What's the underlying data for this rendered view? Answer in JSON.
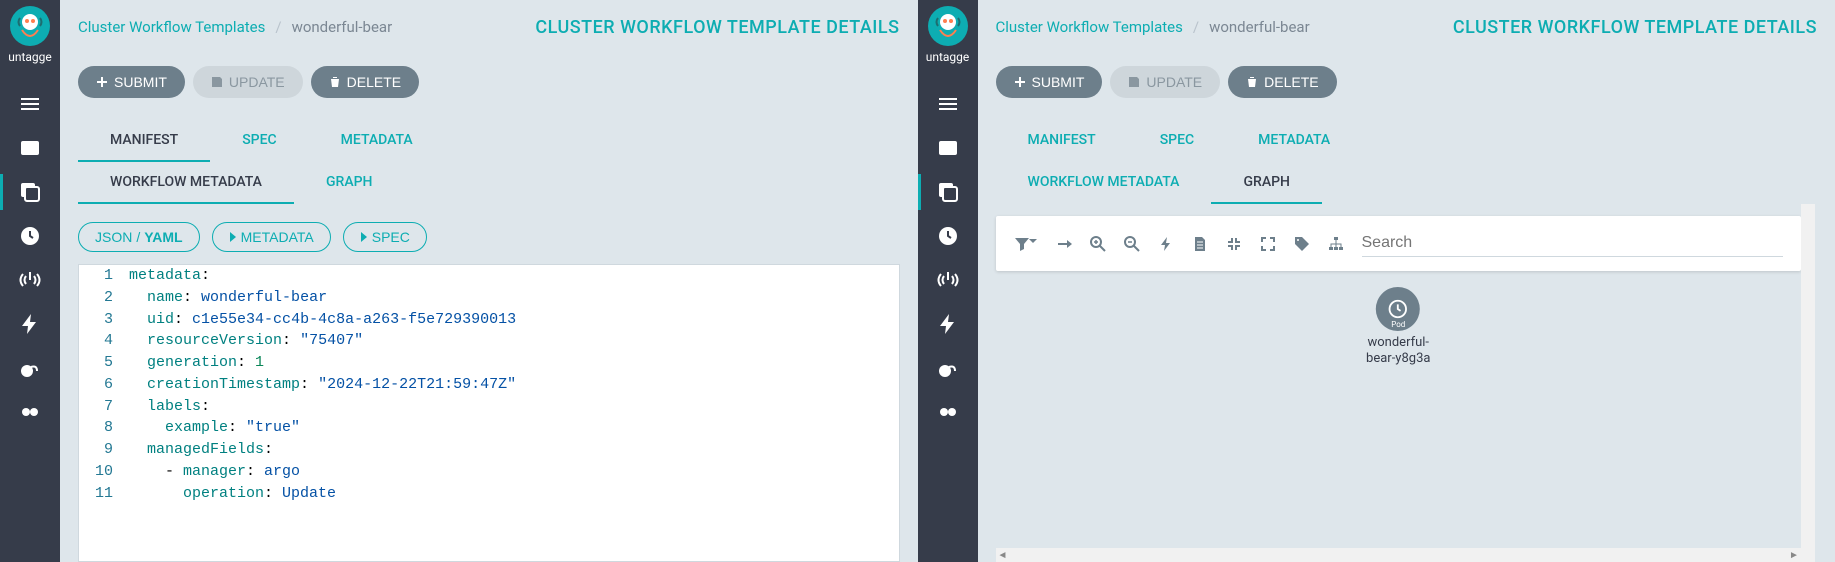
{
  "sidebar": {
    "tag": "untagge",
    "items": [
      {
        "name": "timeline-icon"
      },
      {
        "name": "workflows-icon"
      },
      {
        "name": "templates-icon",
        "active": true
      },
      {
        "name": "cron-icon"
      },
      {
        "name": "sensors-icon"
      },
      {
        "name": "events-icon"
      },
      {
        "name": "reports-icon"
      },
      {
        "name": "plugins-icon"
      }
    ]
  },
  "breadcrumb": {
    "parent": "Cluster Workflow Templates",
    "current": "wonderful-bear"
  },
  "page_title": "CLUSTER WORKFLOW TEMPLATE DETAILS",
  "toolbar": {
    "submit": "SUBMIT",
    "update": "UPDATE",
    "delete": "DELETE"
  },
  "tabs_primary": [
    "MANIFEST",
    "SPEC",
    "METADATA"
  ],
  "tabs_secondary": [
    "WORKFLOW METADATA",
    "GRAPH"
  ],
  "left": {
    "active_primary": 0,
    "active_secondary": 0,
    "pills": {
      "json": "JSON",
      "yaml": "YAML",
      "metadata": "METADATA",
      "spec": "SPEC"
    },
    "code_lines": [
      [
        {
          "t": "k",
          "v": "metadata"
        },
        {
          "t": "p",
          "v": ":"
        }
      ],
      [
        {
          "t": "p",
          "v": "  "
        },
        {
          "t": "k",
          "v": "name"
        },
        {
          "t": "p",
          "v": ": "
        },
        {
          "t": "s",
          "v": "wonderful-bear"
        }
      ],
      [
        {
          "t": "p",
          "v": "  "
        },
        {
          "t": "k",
          "v": "uid"
        },
        {
          "t": "p",
          "v": ": "
        },
        {
          "t": "s",
          "v": "c1e55e34-cc4b-4c8a-a263-f5e729390013"
        }
      ],
      [
        {
          "t": "p",
          "v": "  "
        },
        {
          "t": "k",
          "v": "resourceVersion"
        },
        {
          "t": "p",
          "v": ": "
        },
        {
          "t": "s",
          "v": "\"75407\""
        }
      ],
      [
        {
          "t": "p",
          "v": "  "
        },
        {
          "t": "k",
          "v": "generation"
        },
        {
          "t": "p",
          "v": ": "
        },
        {
          "t": "n",
          "v": "1"
        }
      ],
      [
        {
          "t": "p",
          "v": "  "
        },
        {
          "t": "k",
          "v": "creationTimestamp"
        },
        {
          "t": "p",
          "v": ": "
        },
        {
          "t": "s",
          "v": "\"2024-12-22T21:59:47Z\""
        }
      ],
      [
        {
          "t": "p",
          "v": "  "
        },
        {
          "t": "k",
          "v": "labels"
        },
        {
          "t": "p",
          "v": ":"
        }
      ],
      [
        {
          "t": "p",
          "v": "    "
        },
        {
          "t": "k",
          "v": "example"
        },
        {
          "t": "p",
          "v": ": "
        },
        {
          "t": "s",
          "v": "\"true\""
        }
      ],
      [
        {
          "t": "p",
          "v": "  "
        },
        {
          "t": "k",
          "v": "managedFields"
        },
        {
          "t": "p",
          "v": ":"
        }
      ],
      [
        {
          "t": "p",
          "v": "    - "
        },
        {
          "t": "k",
          "v": "manager"
        },
        {
          "t": "p",
          "v": ": "
        },
        {
          "t": "s",
          "v": "argo"
        }
      ],
      [
        {
          "t": "p",
          "v": "      "
        },
        {
          "t": "k",
          "v": "operation"
        },
        {
          "t": "p",
          "v": ": "
        },
        {
          "t": "s",
          "v": "Update"
        }
      ]
    ]
  },
  "right": {
    "active_primary": -1,
    "active_secondary": 1,
    "search_placeholder": "Search",
    "node": {
      "type": "Pod",
      "label_l1": "wonderful-",
      "label_l2": "bear-y8g3a"
    }
  }
}
